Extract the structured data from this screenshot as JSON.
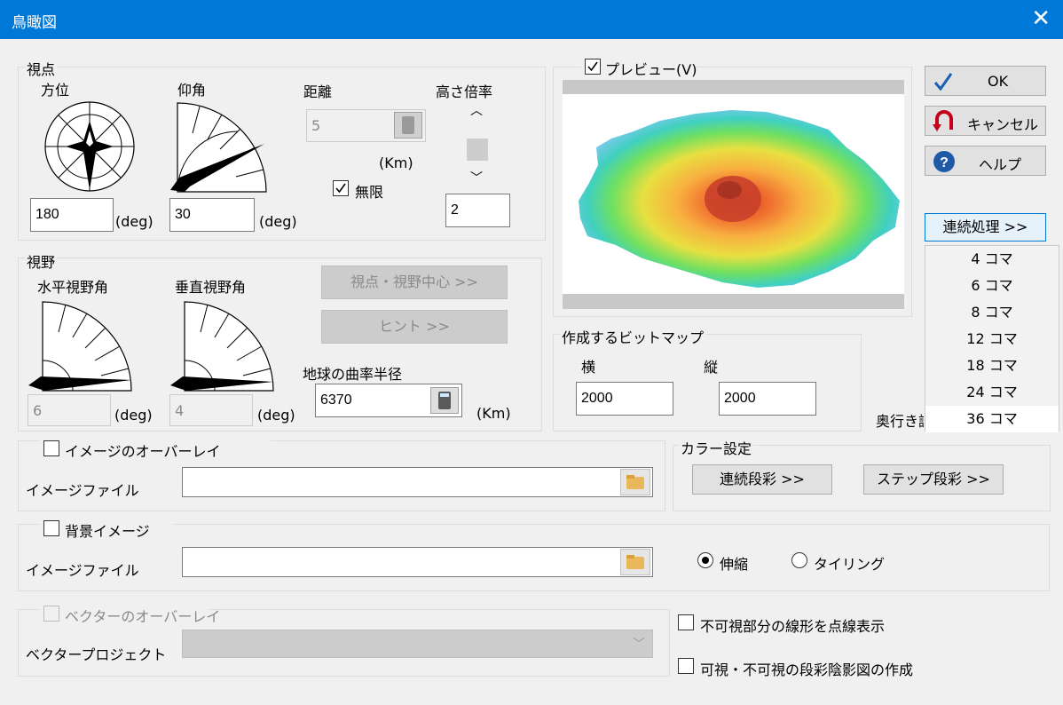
{
  "window": {
    "title": "鳥瞰図",
    "close_icon": "close-icon"
  },
  "viewpoint": {
    "group_label": "視点",
    "azimuth": {
      "label": "方位",
      "value": "180",
      "unit": "(deg)"
    },
    "elevation": {
      "label": "仰角",
      "value": "30",
      "unit": "(deg)"
    },
    "distance": {
      "label": "距離",
      "value": "5",
      "unit": "(Km)",
      "infinite_label": "無限",
      "infinite_checked": true
    },
    "height_scale": {
      "label": "高さ倍率",
      "value": "2"
    }
  },
  "field_of_view": {
    "group_label": "視野",
    "horizontal": {
      "label": "水平視野角",
      "value": "6",
      "unit": "(deg)"
    },
    "vertical": {
      "label": "垂直視野角",
      "value": "4",
      "unit": "(deg)"
    },
    "center_button": "視点・視野中心 >>",
    "hint_button": "ヒント >>",
    "earth_radius": {
      "label": "地球の曲率半径",
      "value": "6370",
      "unit": "(Km)"
    }
  },
  "preview": {
    "label": "プレビュー(V)",
    "checked": true
  },
  "bitmap": {
    "group_label": "作成するビットマップ",
    "width_label": "横",
    "width_value": "2000",
    "height_label": "縦",
    "height_value": "2000"
  },
  "buttons": {
    "ok": "OK",
    "cancel": "キャンセル",
    "help": "ヘルプ"
  },
  "batch": {
    "button_label": "連続処理 >>",
    "items": [
      "4 コマ",
      "6 コマ",
      "8 コマ",
      "12 コマ",
      "18 コマ",
      "24 コマ",
      "36 コマ"
    ],
    "hidden_label": "奥行き調"
  },
  "image_overlay": {
    "label": "イメージのオーバーレイ",
    "checked": false,
    "file_label": "イメージファイル",
    "file_value": ""
  },
  "color_settings": {
    "group_label": "カラー設定",
    "continuous_button": "連続段彩 >>",
    "step_button": "ステップ段彩 >>"
  },
  "background_image": {
    "label": "背景イメージ",
    "checked": false,
    "file_label": "イメージファイル",
    "file_value": "",
    "stretch_label": "伸縮",
    "tiling_label": "タイリング",
    "selected": "stretch"
  },
  "vector_overlay": {
    "label": "ベクターのオーバーレイ",
    "project_label": "ベクタープロジェクト",
    "project_value": ""
  },
  "options": {
    "dashed_hidden_lines": "不可視部分の線形を点線表示",
    "visibility_shade_map": "可視・不可視の段彩陰影図の作成"
  },
  "colors": {
    "title_bar": "#0078d7",
    "ok_check": "#1a5fb4",
    "cancel_arrow": "#c4001a",
    "help_circle": "#1f5aa6",
    "dropdown_highlight": "#cce4f7"
  }
}
